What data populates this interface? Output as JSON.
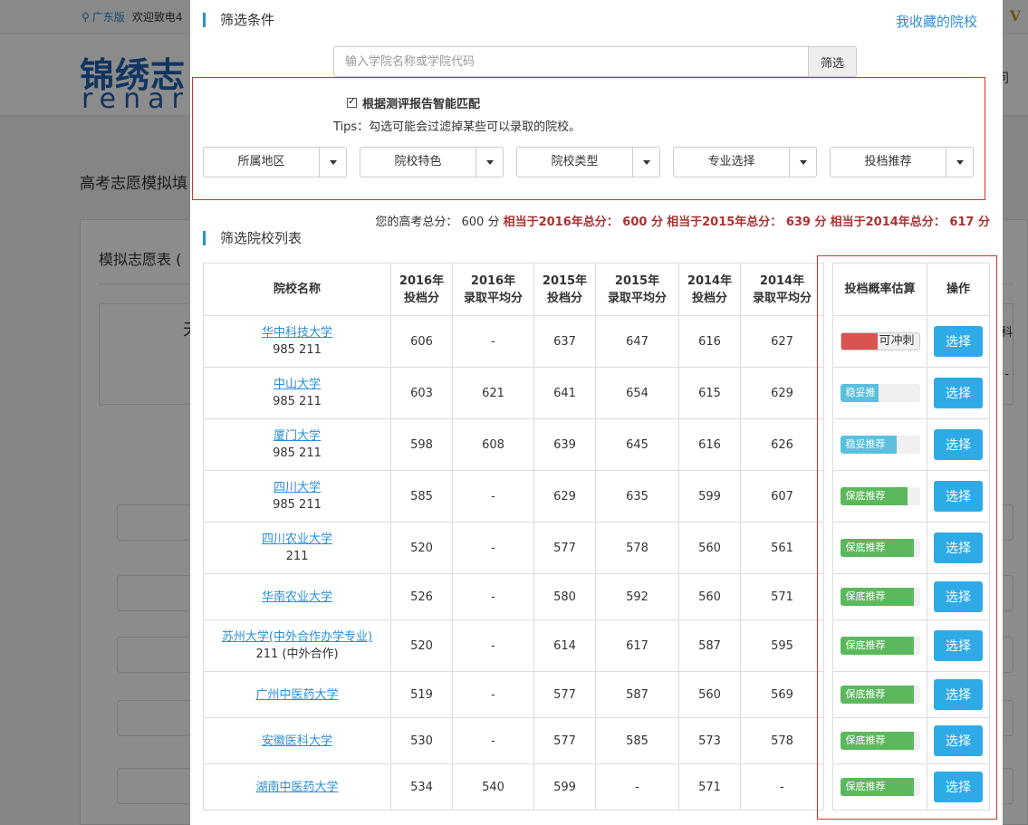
{
  "background": {
    "region": "广东版",
    "welcome": "欢迎致电4",
    "logo_cn": "锦绣志",
    "logo_en": "renaro",
    "nav_right": "问",
    "v_badge": "V",
    "page_title": "高考志愿模拟填",
    "panel_title": "模拟志愿表 (",
    "box_glyph": "天",
    "box_right": "理科",
    "box_dash": "-"
  },
  "modal": {
    "filter_title": "筛选条件",
    "fav_link": "我收藏的院校",
    "search": {
      "placeholder": "输入学院名称或学院代码",
      "button": "筛选"
    },
    "smart_match": "根据测评报告智能匹配",
    "tips": "Tips：勾选可能会过滤掉某些可以录取的院校。",
    "dropdowns": [
      "所属地区",
      "院校特色",
      "院校类型",
      "专业选择",
      "投档推荐"
    ],
    "score": {
      "prefix": "您的高考总分：",
      "total": "600 分",
      "eq2016": "相当于2016年总分： 600 分",
      "eq2015": "相当于2015年总分： 639 分",
      "eq2014": "相当于2014年总分： 617 分"
    },
    "list_title": "筛选院校列表",
    "table": {
      "headers": {
        "name": "院校名称",
        "c1a": "2016年",
        "c1b": "投档分",
        "c2a": "2016年",
        "c2b": "录取平均分",
        "c3a": "2015年",
        "c3b": "投档分",
        "c4a": "2015年",
        "c4b": "录取平均分",
        "c5a": "2014年",
        "c5b": "投档分",
        "c6a": "2014年",
        "c6b": "录取平均分",
        "prob": "投档概率估算",
        "op": "操作"
      },
      "select_label": "选择",
      "rows": [
        {
          "name": "华中科技大学",
          "tag": "985 211",
          "v": [
            "606",
            "-",
            "637",
            "647",
            "616",
            "627"
          ],
          "prob": {
            "label": "可冲刺",
            "style": "red",
            "level": 0.45
          }
        },
        {
          "name": "中山大学",
          "tag": "985 211",
          "v": [
            "603",
            "621",
            "641",
            "654",
            "615",
            "629"
          ],
          "prob": {
            "label": "稳妥推",
            "style": "blue",
            "level": 0.48
          }
        },
        {
          "name": "厦门大学",
          "tag": "985 211",
          "v": [
            "598",
            "608",
            "639",
            "645",
            "616",
            "626"
          ],
          "prob": {
            "label": "稳妥推荐",
            "style": "blue",
            "level": 0.7
          }
        },
        {
          "name": "四川大学",
          "tag": "985 211",
          "v": [
            "585",
            "-",
            "629",
            "635",
            "599",
            "607"
          ],
          "prob": {
            "label": "保底推荐",
            "style": "green",
            "level": 0.84
          }
        },
        {
          "name": "四川农业大学",
          "tag": "211",
          "v": [
            "520",
            "-",
            "577",
            "578",
            "560",
            "561"
          ],
          "prob": {
            "label": "保底推荐",
            "style": "green",
            "level": 0.92
          }
        },
        {
          "name": "华南农业大学",
          "tag": "",
          "v": [
            "526",
            "-",
            "580",
            "592",
            "560",
            "571"
          ],
          "prob": {
            "label": "保底推荐",
            "style": "green",
            "level": 0.92
          }
        },
        {
          "name": "苏州大学(中外合作办学专业)",
          "tag": "211 (中外合作)",
          "v": [
            "520",
            "-",
            "614",
            "617",
            "587",
            "595"
          ],
          "prob": {
            "label": "保底推荐",
            "style": "green",
            "level": 0.92
          }
        },
        {
          "name": "广州中医药大学",
          "tag": "",
          "v": [
            "519",
            "-",
            "577",
            "587",
            "560",
            "569"
          ],
          "prob": {
            "label": "保底推荐",
            "style": "green",
            "level": 0.92
          }
        },
        {
          "name": "安徽医科大学",
          "tag": "",
          "v": [
            "530",
            "-",
            "577",
            "585",
            "573",
            "578"
          ],
          "prob": {
            "label": "保底推荐",
            "style": "green",
            "level": 0.92
          }
        },
        {
          "name": "湖南中医药大学",
          "tag": "",
          "v": [
            "534",
            "540",
            "599",
            "-",
            "571",
            "-"
          ],
          "prob": {
            "label": "保底推荐",
            "style": "green",
            "level": 0.92
          }
        }
      ]
    }
  }
}
